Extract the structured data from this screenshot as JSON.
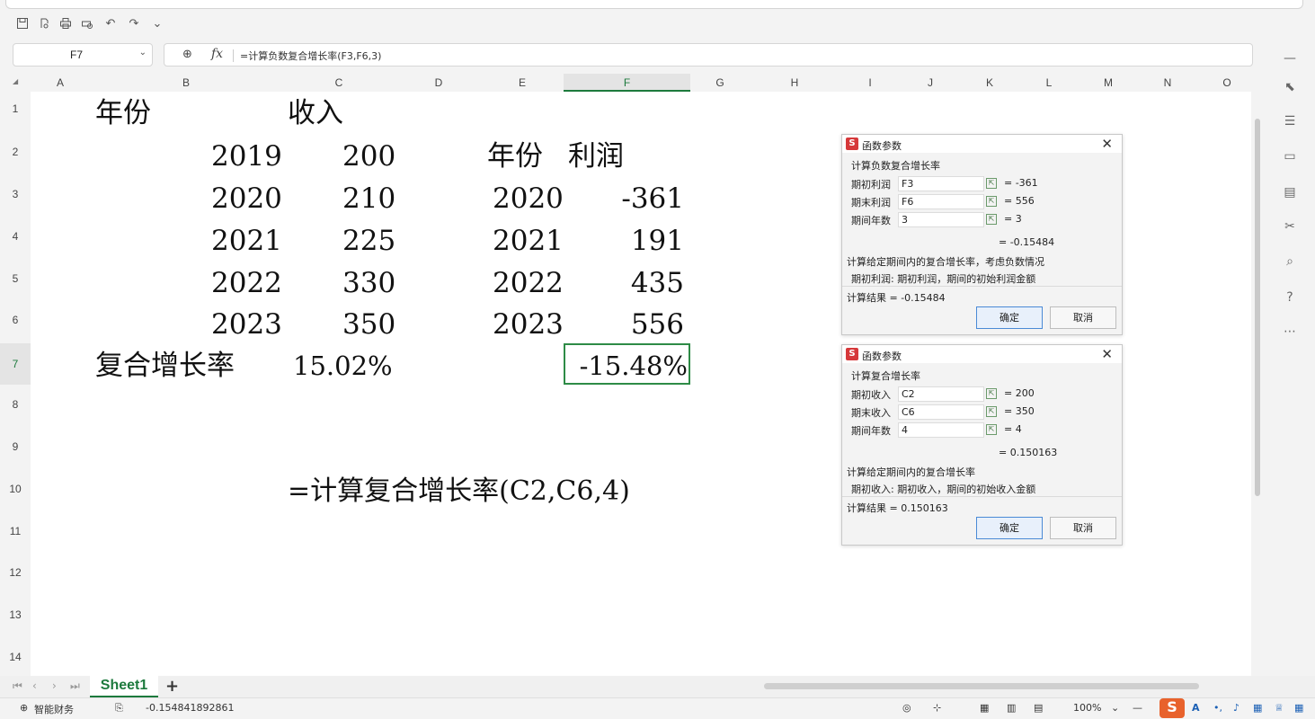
{
  "name_box": "F7",
  "formula_bar": {
    "formula": "=计算负数复合增长率(F3,F6,3)"
  },
  "columns": [
    "A",
    "B",
    "C",
    "D",
    "E",
    "F",
    "G",
    "H",
    "I",
    "J",
    "K",
    "L",
    "M",
    "N",
    "O"
  ],
  "rows": [
    "1",
    "2",
    "3",
    "4",
    "5",
    "6",
    "7",
    "8",
    "9",
    "10",
    "11",
    "12",
    "13",
    "14"
  ],
  "selected_column": "F",
  "selected_row": "7",
  "cells": {
    "a1": "年份",
    "c1": "收入",
    "b2": "2019",
    "c2": "200",
    "b3": "2020",
    "c3": "210",
    "b4": "2021",
    "c4": "225",
    "b5": "2022",
    "c5": "330",
    "b6": "2023",
    "c6": "350",
    "e2": "年份",
    "f2": "利润",
    "e3": "2020",
    "f3": "-361",
    "e4": "2021",
    "f4": "191",
    "e5": "2022",
    "f5": "435",
    "e6": "2023",
    "f6": "556",
    "a7": "复合增长率",
    "c7": "15.02%",
    "f7": "-15.48%",
    "c10": "=计算复合增长率(C2,C6,4)"
  },
  "dialog1": {
    "title": "函数参数",
    "func_name": "计算负数复合增长率",
    "params": [
      {
        "label": "期初利润",
        "value": "F3",
        "result": "= -361"
      },
      {
        "label": "期末利润",
        "value": "F6",
        "result": "= 556"
      },
      {
        "label": "期间年数",
        "value": "3",
        "result": "= 3"
      }
    ],
    "formula_result": "= -0.15484",
    "description": "计算给定期间内的复合增长率，考虑负数情况",
    "param_desc": "期初利润: 期初利润，期间的初始利润金额",
    "calc_result": "计算结果 = -0.15484",
    "ok": "确定",
    "cancel": "取消"
  },
  "dialog2": {
    "title": "函数参数",
    "func_name": "计算复合增长率",
    "params": [
      {
        "label": "期初收入",
        "value": "C2",
        "result": "= 200"
      },
      {
        "label": "期末收入",
        "value": "C6",
        "result": "= 350"
      },
      {
        "label": "期间年数",
        "value": "4",
        "result": "= 4"
      }
    ],
    "formula_result": "= 0.150163",
    "description": "计算给定期间内的复合增长率",
    "param_desc": "期初收入: 期初收入，期间的初始收入金额",
    "calc_result": "计算结果 = 0.150163",
    "ok": "确定",
    "cancel": "取消"
  },
  "sheet_tab": "Sheet1",
  "status": {
    "finance": "智能财务",
    "value": "-0.154841892861",
    "zoom": "100%"
  },
  "icons": {
    "quick_access": [
      "save-icon",
      "export-icon",
      "print-icon",
      "print-preview-icon",
      "undo-icon",
      "redo-icon",
      "more-icon"
    ],
    "right_toolbar": [
      "select-icon",
      "settings-icon",
      "sheet-icon",
      "chart-icon",
      "tools-icon",
      "zoom-icon",
      "help-icon",
      "more-icon"
    ]
  }
}
